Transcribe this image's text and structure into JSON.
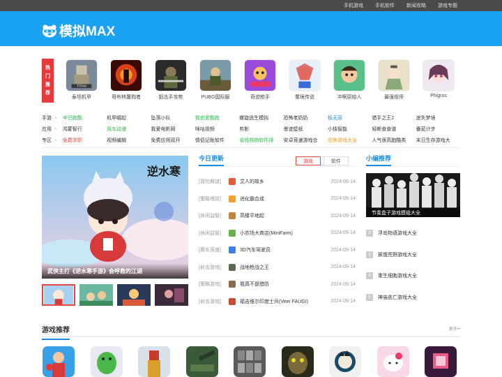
{
  "topbar": {
    "links": [
      "手机游戏",
      "手机软件",
      "新闻攻略",
      "游戏专题"
    ]
  },
  "header": {
    "logo_text": "模拟MAX"
  },
  "hot": {
    "label_chars": [
      "热",
      "门",
      "推",
      "荐"
    ],
    "games": [
      {
        "name": "泰坦机甲",
        "icon": "titan-mech-icon"
      },
      {
        "name": "哥布林屠戮者",
        "icon": "goblin-slayer-icon"
      },
      {
        "name": "狙击手攻势",
        "icon": "sniper-offensive-icon"
      },
      {
        "name": "PUBG国际服",
        "icon": "pubg-icon"
      },
      {
        "name": "奇迹枪手",
        "icon": "miracle-gunner-icon"
      },
      {
        "name": "蜀境传说",
        "icon": "shu-legend-icon"
      },
      {
        "name": "冲啊原始人",
        "icon": "caveman-icon"
      },
      {
        "name": "最强祖师",
        "icon": "strongest-master-icon"
      },
      {
        "name": "Phigros",
        "icon": "phigros-icon"
      }
    ]
  },
  "categories": [
    {
      "label": "手游",
      "items": [
        {
          "text": "辛巴跑酷",
          "color": "green"
        },
        {
          "text": "机甲崛起",
          "color": ""
        },
        {
          "text": "坠落小队",
          "color": ""
        },
        {
          "text": "我也爱酷跑",
          "color": "green"
        },
        {
          "text": "螺旋逃生模拟",
          "color": ""
        },
        {
          "text": "恐怖老奶奶",
          "color": ""
        },
        {
          "text": "极无双",
          "color": "blue"
        },
        {
          "text": "猎手之王2",
          "color": ""
        },
        {
          "text": "迷失梦境",
          "color": ""
        }
      ]
    },
    {
      "label": "应用",
      "items": [
        {
          "text": "鸿蒙智行",
          "color": ""
        },
        {
          "text": "风车动漫",
          "color": "green"
        },
        {
          "text": "我爱电影网",
          "color": ""
        },
        {
          "text": "咪咕视频",
          "color": ""
        },
        {
          "text": "剪影",
          "color": ""
        },
        {
          "text": "墨迹壁纸",
          "color": ""
        },
        {
          "text": "小桔智能",
          "color": ""
        },
        {
          "text": "轻断食食谱",
          "color": ""
        },
        {
          "text": "番茄计步",
          "color": ""
        }
      ]
    },
    {
      "label": "专区",
      "items": [
        {
          "text": "免费求职",
          "color": "red"
        },
        {
          "text": "视频编辑",
          "color": ""
        },
        {
          "text": "免费应用双开",
          "color": ""
        },
        {
          "text": "情侣记账软件",
          "color": ""
        },
        {
          "text": "省钱购物软件排",
          "color": "green"
        },
        {
          "text": "安卓竞速游戏合",
          "color": ""
        },
        {
          "text": "恐怖游戏大全",
          "color": "orange"
        },
        {
          "text": "人气很高跑酷类",
          "color": ""
        },
        {
          "text": "末日生存游戏大",
          "color": ""
        }
      ]
    }
  ],
  "banner": {
    "caption": "武侠主打《逆水寒手游》会呼救的江湖",
    "art_title": "逆水寒"
  },
  "updates": {
    "title": "今日更新",
    "tabs": [
      "游戏",
      "软件"
    ],
    "rows": [
      {
        "cat": "[冒险解谜]",
        "title": "艾人的故乡",
        "date": "2024-09-14",
        "color": "#e85a3c"
      },
      {
        "cat": "[策略塔防]",
        "title": "进化霸合成",
        "date": "2024-09-14",
        "color": "#f0a030"
      },
      {
        "cat": "[休闲益智]",
        "title": "高楼平地起",
        "date": "2024-09-14",
        "color": "#c0843a"
      },
      {
        "cat": "[休闲益智]",
        "title": "小农场大商店(MiniFarm)",
        "date": "2024-09-14",
        "color": "#6ab04c"
      },
      {
        "cat": "[赛车竞速]",
        "title": "3D汽车驾驶员",
        "date": "2024-09-14",
        "color": "#3c7de8"
      },
      {
        "cat": "[射击游戏]",
        "title": "战地枪战之王",
        "date": "2024-09-14",
        "color": "#5a6a50"
      },
      {
        "cat": "[策略游戏]",
        "title": "我真不是猎防",
        "date": "2024-09-14",
        "color": "#8a6a4a"
      },
      {
        "cat": "[射击游戏]",
        "title": "福吉维尔印度士兵(Veer FAUGI)",
        "date": "2024-09-14",
        "color": "#c84a2a"
      }
    ]
  },
  "editor": {
    "title": "小编推荐",
    "feature_caption": "节奏盒子游戏模组大全",
    "ranks": [
      {
        "n": "2",
        "title": "浮岛物语游戏大全"
      },
      {
        "n": "3",
        "title": "挨饿荒野游戏大全"
      },
      {
        "n": "4",
        "title": "重生细胞游戏大全"
      },
      {
        "n": "5",
        "title": "神庙逃亡游戏大全"
      }
    ]
  },
  "recommend": {
    "title": "游戏推荐",
    "more": "更多",
    "games": [
      "boxer-game-icon",
      "green-monster-icon",
      "iron-hero-icon",
      "artillery-icon",
      "parking-lot-icon",
      "monster-face-icon",
      "dont-starve-icon",
      "hello-kitty-icon",
      "cube-game-icon"
    ]
  }
}
